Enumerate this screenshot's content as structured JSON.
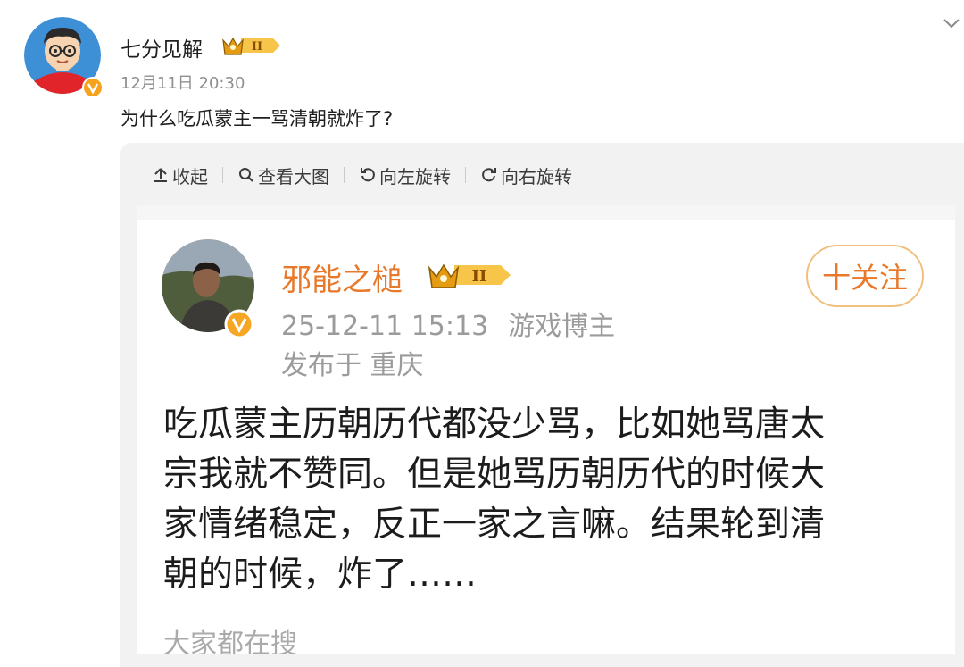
{
  "post": {
    "author": "七分见解",
    "time": "12月11日 20:30",
    "text": "为什么吃瓜蒙主一骂清朝就炸了?"
  },
  "toolbar": {
    "collapse": "收起",
    "view_large": "查看大图",
    "rotate_left": "向左旋转",
    "rotate_right": "向右旋转"
  },
  "screenshot": {
    "author": "邪能之槌",
    "follow_label": "十关注",
    "date": "25-12-11 15:13",
    "tag": "游戏博主",
    "location": "发布于 重庆",
    "body_lines": [
      "吃瓜蒙主历朝历代都没少骂，比如她骂唐太",
      "宗我就不赞同。但是她骂历朝历代的时候大",
      "家情绪稳定，反正一家之言嘛。结果轮到清",
      "朝的时候，炸了……"
    ],
    "search_hint": "大家都在搜"
  },
  "colors": {
    "accent_orange": "#e8792a",
    "follow_border": "#f0c07e",
    "meta_gray": "#8f8f8f"
  },
  "icons": [
    "chevron-down-icon",
    "verified-badge-icon",
    "crown-level-icon",
    "arrow-up-icon",
    "magnifier-icon",
    "rotate-left-icon",
    "rotate-right-icon"
  ]
}
